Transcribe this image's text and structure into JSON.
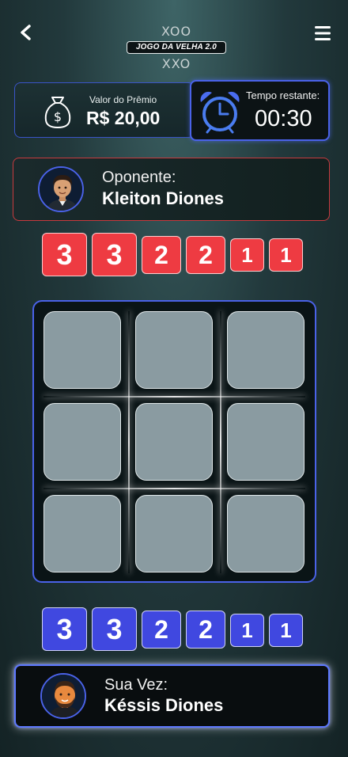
{
  "header": {
    "back_icon": "chevron-left-icon",
    "menu_icon": "hamburger-menu-icon",
    "logo": {
      "title": "JOGO DA VELHA 2.0",
      "top_row": "XOO",
      "bottom_row": "XXO"
    }
  },
  "prize": {
    "icon": "money-bag-icon",
    "label": "Valor do Prêmio",
    "value": "R$ 20,00"
  },
  "timer": {
    "icon": "alarm-clock-icon",
    "label": "Tempo restante:",
    "value": "00:30"
  },
  "opponent": {
    "label": "Oponente:",
    "name": "Kleiton Diones",
    "pieces": [
      "3",
      "3",
      "2",
      "2",
      "1",
      "1"
    ],
    "color": "#ee3b42"
  },
  "board": {
    "cells": [
      "",
      "",
      "",
      "",
      "",
      "",
      "",
      "",
      ""
    ]
  },
  "player": {
    "label": "Sua Vez:",
    "name": "Késsis Diones",
    "pieces": [
      "3",
      "3",
      "2",
      "2",
      "1",
      "1"
    ],
    "color": "#4048e0"
  },
  "colors": {
    "accent_blue": "#4a62e8",
    "accent_red": "#c83a3e",
    "cell": "#8a9ba1"
  }
}
